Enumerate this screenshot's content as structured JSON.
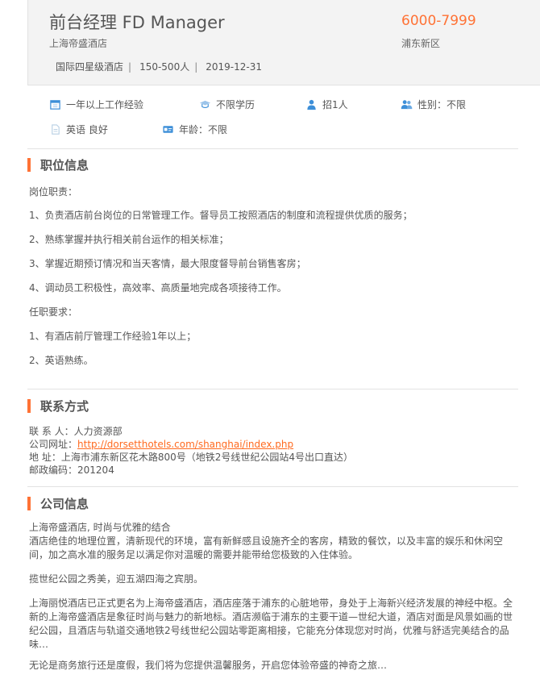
{
  "header": {
    "title": "前台经理 FD Manager",
    "salary": "6000-7999",
    "company": "上海帝盛酒店",
    "location": "浦东新区",
    "meta": [
      "国际四星级酒店",
      "150-500人",
      "2019-12-31"
    ],
    "separator": "|"
  },
  "attrs": {
    "experience": "一年以上工作经验",
    "education": "不限学历",
    "headcount": "招1人",
    "gender": "性别：不限",
    "language": "英语 良好",
    "age": "年龄：不限"
  },
  "job_info": {
    "title": "职位信息",
    "duty_label": "岗位职责：",
    "duties": [
      "1、负责酒店前台岗位的日常管理工作。督导员工按照酒店的制度和流程提供优质的服务；",
      "2、熟练掌握并执行相关前台运作的相关标准；",
      "3、掌握近期预订情况和当天客情，最大限度督导前台销售客房；",
      "4、调动员工积极性，高效率、高质量地完成各项接待工作。"
    ],
    "req_label": "任职要求：",
    "requirements": [
      "1、有酒店前厅管理工作经验1年以上；",
      "2、英语熟练。"
    ]
  },
  "contact": {
    "title": "联系方式",
    "person_label": "联 系 人：",
    "person": "人力资源部",
    "website_label": "公司网址：",
    "website": "http://dorsetthotels.com/shanghai/index.php",
    "address_label": "地 址：",
    "address": "上海市浦东新区花木路800号（地铁2号线世纪公园站4号出口直达）",
    "zip_label": "邮政编码：",
    "zip": "201204"
  },
  "company_info": {
    "title": "公司信息",
    "p1": "上海帝盛酒店, 时尚与优雅的结合",
    "p2": "酒店绝佳的地理位置，清新现代的环境，富有新鲜感且设施齐全的客房，精致的餐饮，以及丰富的娱乐和休闲空间，加之高水准的服务足以满足你对温暖的需要并能带给您极致的入住体验。",
    "p3": "揽世纪公园之秀美，迎五湖四海之宾朋。",
    "p4": "上海丽悦酒店已正式更名为上海帝盛酒店，酒店座落于浦东的心脏地带，身处于上海新兴经济发展的神经中枢。全新的上海帝盛酒店是象征时尚与魅力的新地标。酒店濒临于浦东的主要干道—世纪大道，酒店对面是风景如画的世纪公园，且酒店与轨道交通地铁2号线世纪公园站零距离相接，它能充分体现您对时尚，优雅与舒适完美结合的品味…",
    "p5": "无论是商务旅行还是度假，我们将为您提供温馨服务，开启您体验帝盛的神奇之旅…"
  },
  "icons": {
    "accent": "#ff7235",
    "icon_blue": "#3d8fd8"
  }
}
